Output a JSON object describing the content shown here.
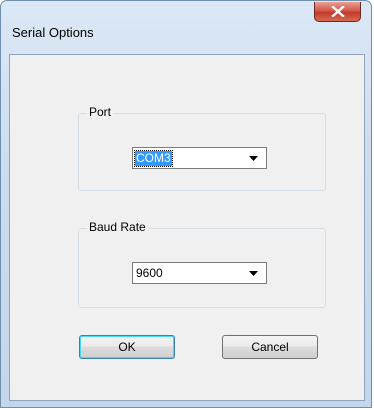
{
  "window": {
    "title": "Serial Options"
  },
  "port": {
    "label": "Port",
    "selected_value": "COM3"
  },
  "baud": {
    "label": "Baud Rate",
    "selected_value": "9600"
  },
  "buttons": {
    "ok_label": "OK",
    "cancel_label": "Cancel"
  },
  "icons": {
    "close": "close-icon",
    "dropdown": "chevron-down-icon"
  },
  "colors": {
    "selection": "#3399ff",
    "close_button": "#c13a2b",
    "frame": "#cddcee"
  }
}
